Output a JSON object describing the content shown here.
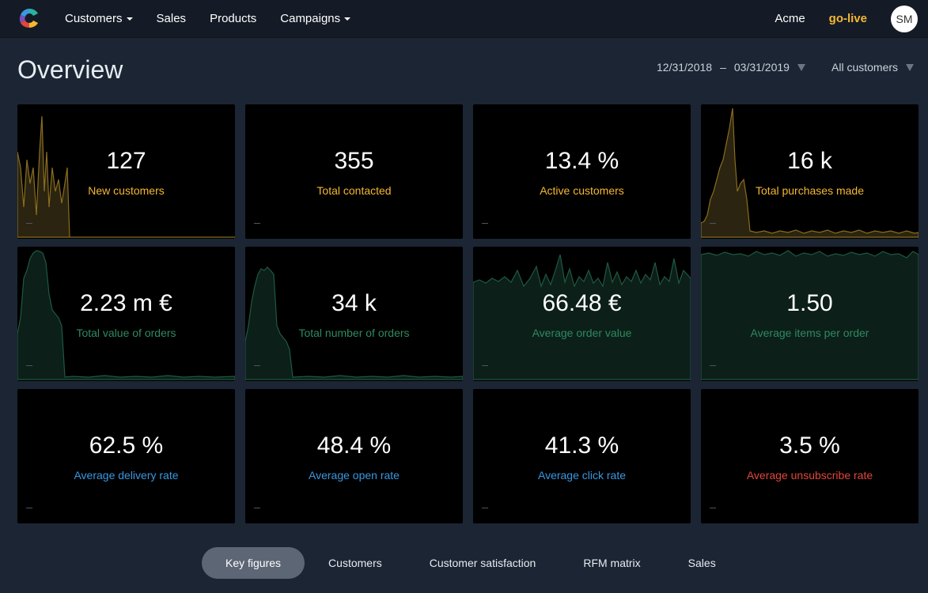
{
  "nav": {
    "items": [
      {
        "label": "Customers",
        "dropdown": true
      },
      {
        "label": "Sales",
        "dropdown": false
      },
      {
        "label": "Products",
        "dropdown": false
      },
      {
        "label": "Campaigns",
        "dropdown": true
      }
    ],
    "account": "Acme",
    "status": "go-live",
    "avatar_initials": "SM"
  },
  "header": {
    "title": "Overview",
    "date_from": "12/31/2018",
    "date_sep": "–",
    "date_to": "03/31/2019",
    "customer_filter": "All customers"
  },
  "colors": {
    "yellow": "#f5b731",
    "green": "#2e8a5e",
    "blue": "#3a97e0",
    "red": "#e0463b"
  },
  "cards": [
    {
      "value": "127",
      "label": "New customers",
      "color": "yellow"
    },
    {
      "value": "355",
      "label": "Total contacted",
      "color": "yellow"
    },
    {
      "value": "13.4 %",
      "label": "Active customers",
      "color": "yellow"
    },
    {
      "value": "16 k",
      "label": "Total purchases made",
      "color": "yellow"
    },
    {
      "value": "2.23 m €",
      "label": "Total value of orders",
      "color": "green"
    },
    {
      "value": "34 k",
      "label": "Total number of orders",
      "color": "green"
    },
    {
      "value": "66.48 €",
      "label": "Average order value",
      "color": "green"
    },
    {
      "value": "1.50",
      "label": "Average items per order",
      "color": "green"
    },
    {
      "value": "62.5 %",
      "label": "Average delivery rate",
      "color": "blue"
    },
    {
      "value": "48.4 %",
      "label": "Average open rate",
      "color": "blue"
    },
    {
      "value": "41.3 %",
      "label": "Average click rate",
      "color": "blue"
    },
    {
      "value": "3.5 %",
      "label": "Average unsubscribe rate",
      "color": "red"
    }
  ],
  "tabs": [
    {
      "label": "Key figures",
      "active": true
    },
    {
      "label": "Customers",
      "active": false
    },
    {
      "label": "Customer satisfaction",
      "active": false
    },
    {
      "label": "RFM matrix",
      "active": false
    },
    {
      "label": "Sales",
      "active": false
    }
  ]
}
